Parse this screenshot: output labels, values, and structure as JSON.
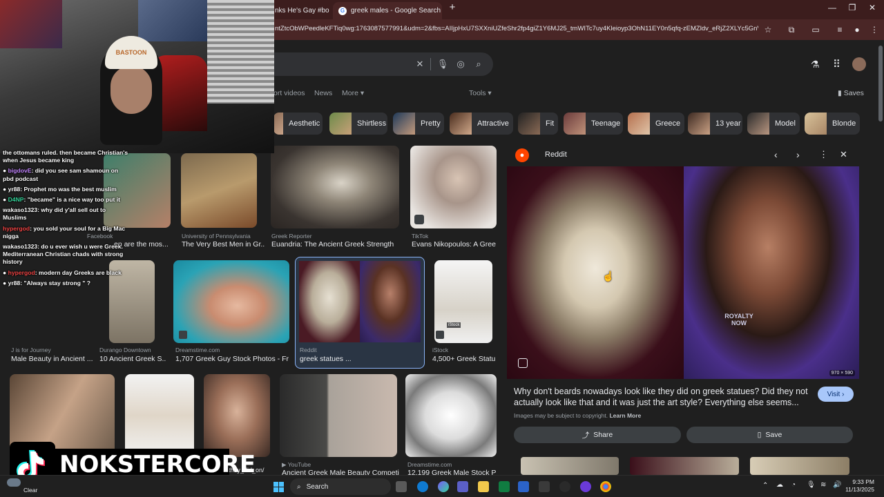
{
  "browser": {
    "tabs": [
      {
        "label": "nks He's Gay #bo"
      },
      {
        "label": "greek males - Google Search"
      }
    ],
    "new_tab": "+",
    "url": "ntZtcObWPeedleKFTiq0wg:1763087577991&udm=2&fbs=AIIjpHxU7SXXniUZfeShr2fp4giZ1Y6MJ25_tmWITc7uy4Kleioyp3OhN11EY0n5qfq-zEMZldv_eRjZ2XLYc5GnVnMEI..."
  },
  "google": {
    "nav_tabs": [
      "ort videos",
      "News",
      "More",
      "Tools"
    ],
    "saves": "Saves",
    "chips": [
      "Aesthetic",
      "Shirtless",
      "Pretty",
      "Attractive",
      "Fit",
      "Teenage",
      "Greece",
      "13 year",
      "Model",
      "Blonde"
    ],
    "results_row1": [
      {
        "source": "man University S...",
        "title": "en are the mos..."
      },
      {
        "source": "Facebook",
        "title": ""
      },
      {
        "source": "University of Pennsylvania",
        "title": "The Very Best Men in Gr..."
      },
      {
        "source": "Greek Reporter",
        "title": "Euandria: The Ancient Greek Strength ..."
      },
      {
        "source": "TikTok",
        "title": "Evans Nikopoulos: A Gree..."
      }
    ],
    "results_row2": [
      {
        "source": "J is for Journey",
        "title": "Male Beauty in Ancient ..."
      },
      {
        "source": "Durango Downtown",
        "title": "10 Ancient Greek S..."
      },
      {
        "source": "Dreamstime.com",
        "title": "1,707 Greek Guy Stock Photos - Free..."
      },
      {
        "source": "Reddit",
        "title": "greek statues ..."
      },
      {
        "source": "iStock",
        "title": "4,500+ Greek Statu..."
      }
    ],
    "results_row3": [
      {
        "source": "YouTube",
        "title": "Ancient Greek Male Beauty Competi..."
      },
      {
        "source": "Dreamstime.com",
        "title": "12,199 Greek Male Stock Ph..."
      },
      {
        "source": "",
        "title": "they_did_on/"
      }
    ],
    "istock_label": "iStock",
    "panel": {
      "source": "Reddit",
      "title": "Why don't beards nowadays look like they did on greek statues? Did they not actually look like that and it was just the art style? Everything else seems...",
      "visit": "Visit",
      "copyright": "Images may be subject to copyright.",
      "learn_more": "Learn More",
      "share": "Share",
      "save": "Save",
      "dims": "970 × 590",
      "watermark": "ROYALTY NOW"
    }
  },
  "stream": {
    "hat_text": "BASTOON",
    "chat": [
      {
        "user": "",
        "text": "the ottomans ruled. then became Christian's when Jesus became king",
        "color": "#ffffff"
      },
      {
        "user": "bigdovE",
        "text": ": did you see sam shamoun on pbd podcast",
        "color": "#c084fc"
      },
      {
        "user": "yr88",
        "text": ": Prophet mo was the best muslim",
        "color": "#ffffff"
      },
      {
        "user": "D4NP",
        "text": ": \"became\" is a nice way too put it",
        "color": "#34d399"
      },
      {
        "user": "wakaso1323",
        "text": ": why did y'all sell out to Muslims",
        "color": "#ffffff"
      },
      {
        "user": "hypergod",
        "text": ": you sold your soul for a Big Mac nigga",
        "color": "#ef4444"
      },
      {
        "user": "wakaso1323",
        "text": ": do u ever wish u were Greek. Mediterranean Christian chads with strong history",
        "color": "#ffffff"
      },
      {
        "user": "hypergod",
        "text": ": modern day Greeks are black",
        "color": "#ef4444"
      },
      {
        "user": "yr88",
        "text": ": \"Always stay strong \" ?",
        "color": "#ffffff"
      }
    ],
    "brand": "NOKSTERCORE"
  },
  "taskbar": {
    "weather": "Clear",
    "search": "Search",
    "time": "9:33 PM",
    "date": "11/13/2025"
  }
}
